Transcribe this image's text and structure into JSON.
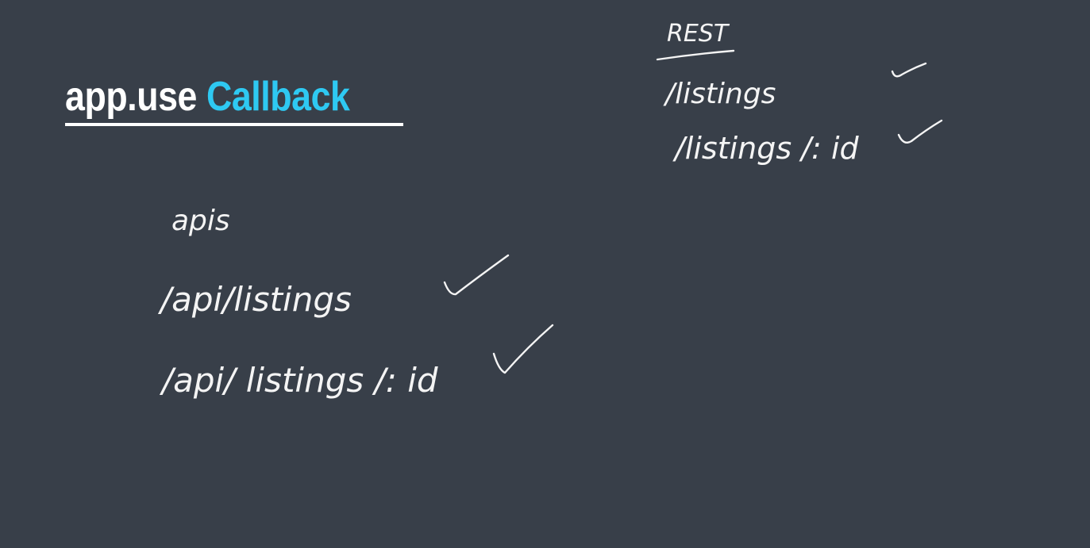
{
  "slide": {
    "title_main": "app.use ",
    "title_accent": "Callback",
    "accent_color": "#2ec9f2",
    "background_color": "#383f49"
  },
  "notes_left": {
    "heading": "apis",
    "route1": "/api/listings",
    "route2": "/api/ listings /: id"
  },
  "notes_right": {
    "heading": "REST",
    "route1": "/listings",
    "route2": "/listings /: id"
  },
  "marks": {
    "check_icon": "check-icon"
  }
}
